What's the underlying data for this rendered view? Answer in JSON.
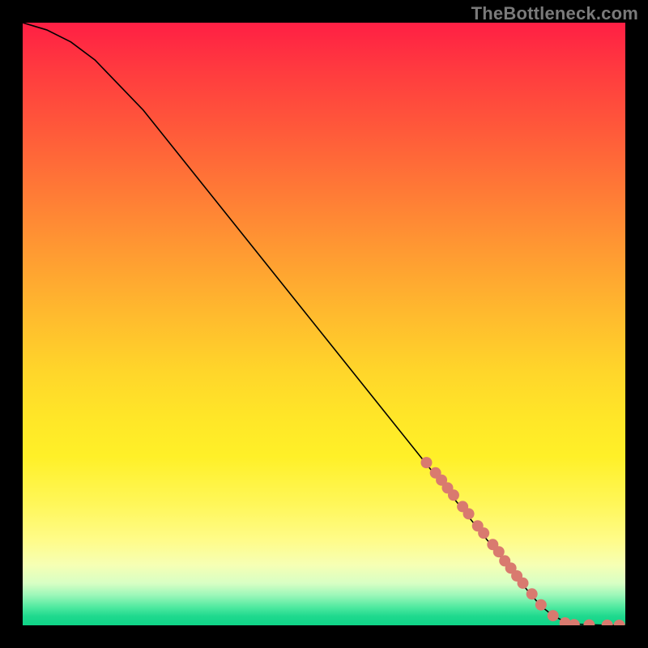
{
  "watermark": {
    "text": "TheBottleneck.com"
  },
  "colors": {
    "curve": "#000000",
    "marker_fill": "#d97a6f",
    "marker_stroke": "#c46a60"
  },
  "chart_data": {
    "type": "line",
    "title": "",
    "xlabel": "",
    "ylabel": "",
    "xlim": [
      0,
      100
    ],
    "ylim": [
      0,
      100
    ],
    "grid": false,
    "series": [
      {
        "name": "curve",
        "x": [
          0,
          4,
          8,
          12,
          20,
          30,
          40,
          50,
          60,
          70,
          76,
          80,
          84,
          86,
          88,
          90,
          92,
          94,
          96,
          98,
          100
        ],
        "y": [
          100,
          98.8,
          96.8,
          93.8,
          85.5,
          73.0,
          60.5,
          48.0,
          35.5,
          23.0,
          15.5,
          10.5,
          5.5,
          3.2,
          1.6,
          0.6,
          0.2,
          0.1,
          0.05,
          0.02,
          0.0
        ]
      }
    ],
    "markers": {
      "name": "points",
      "x": [
        67,
        68.5,
        69.5,
        70.5,
        71.5,
        73,
        74,
        75.5,
        76.5,
        78,
        79,
        80,
        81,
        82,
        83,
        84.5,
        86,
        88,
        90,
        91.5,
        94,
        97,
        99
      ],
      "y": [
        27.0,
        25.3,
        24.1,
        22.8,
        21.6,
        19.7,
        18.5,
        16.5,
        15.3,
        13.4,
        12.2,
        10.7,
        9.5,
        8.2,
        7.0,
        5.2,
        3.4,
        1.6,
        0.4,
        0.1,
        0.05,
        0.02,
        0.0
      ]
    }
  }
}
